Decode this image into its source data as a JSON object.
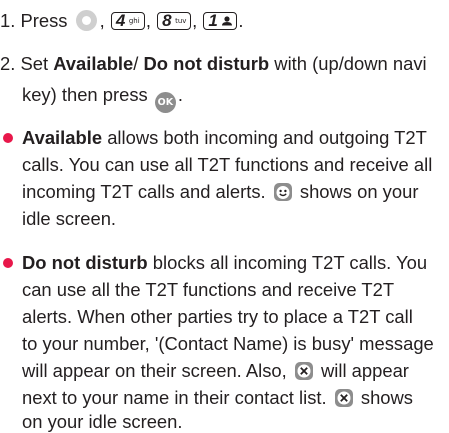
{
  "step1": {
    "prefix": "1. Press",
    "sep1": ",",
    "sep2": ",",
    "sep3": ",",
    "end": ".",
    "key4": {
      "num": "4",
      "letters": "ghi"
    },
    "key8": {
      "num": "8",
      "letters": "tuv"
    },
    "key1": {
      "num": "1",
      "letters": ""
    }
  },
  "step2": {
    "pre": "2. Set",
    "available": "Available",
    "slash": "/",
    "dnd": "Do not disturb",
    "post": "with (up/down navi",
    "line2": "key) then press",
    "end": ".",
    "ok_label": "OK"
  },
  "bullet1": {
    "title": "Available",
    "l1": "allows both incoming and outgoing T2T",
    "l2": "calls. You can use all T2T functions and receive all",
    "l3": "incoming T2T calls and alerts.",
    "l3b": "shows on your",
    "l4": "idle screen."
  },
  "bullet2": {
    "title": "Do not disturb",
    "l1": "blocks all incoming T2T calls. You",
    "l2": "can use all the T2T functions and receive T2T",
    "l3": "alerts. When other parties try to place a T2T call",
    "l4": "to your number, '(Contact Name) is busy' message",
    "l5a": "will appear on their screen. Also,",
    "l5b": "will appear",
    "l6a": "next to your name in their contact list.",
    "l6b": "shows",
    "l7": "on your idle screen."
  },
  "colors": {
    "text": "#231f20",
    "bullet": "#e8174a",
    "key_gray": "#8d8d8d"
  },
  "icons": {
    "center_key": "navigation-center-key-icon",
    "ok": "ok-key-icon",
    "available": "available-status-icon",
    "busy": "busy-status-icon"
  }
}
